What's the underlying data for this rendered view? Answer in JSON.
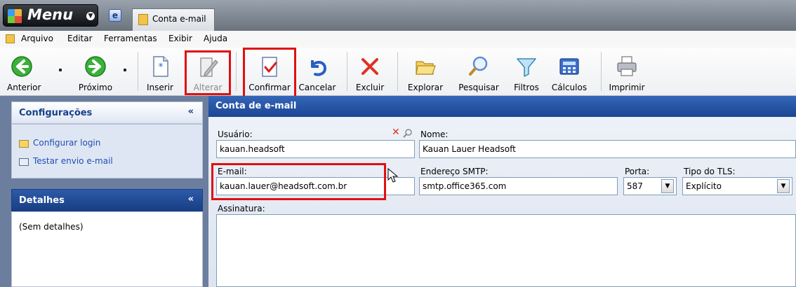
{
  "topbar": {
    "menu_label": "Menu",
    "doc_tab_label": "Conta e-mail"
  },
  "menubar": {
    "items": [
      "Arquivo",
      "Editar",
      "Ferramentas",
      "Exibir",
      "Ajuda"
    ]
  },
  "toolbar": {
    "buttons": [
      {
        "label": "Anterior",
        "icon": "arrow-left-icon"
      },
      {
        "label": "Próximo",
        "icon": "arrow-right-icon"
      },
      {
        "label": "Inserir",
        "icon": "new-document-icon"
      },
      {
        "label": "Alterar",
        "icon": "pencil-edit-icon",
        "disabled": true
      },
      {
        "label": "Confirmar",
        "icon": "checkmark-icon"
      },
      {
        "label": "Cancelar",
        "icon": "undo-icon"
      },
      {
        "label": "Excluir",
        "icon": "delete-x-icon"
      },
      {
        "label": "Explorar",
        "icon": "folder-open-icon"
      },
      {
        "label": "Pesquisar",
        "icon": "magnifier-icon"
      },
      {
        "label": "Filtros",
        "icon": "funnel-icon"
      },
      {
        "label": "Cálculos",
        "icon": "calculator-icon"
      },
      {
        "label": "Imprimir",
        "icon": "printer-icon"
      }
    ],
    "highlight_color": "#e01010"
  },
  "sidebar": {
    "config_title": "Configurações",
    "config_links": [
      "Configurar login",
      "Testar envio e-mail"
    ],
    "details_title": "Detalhes",
    "details_text": "(Sem detalhes)"
  },
  "form": {
    "title": "Conta de e-mail",
    "usuario": {
      "label": "Usuário:",
      "value": "kauan.headsoft"
    },
    "nome": {
      "label": "Nome:",
      "value": "Kauan Lauer Headsoft"
    },
    "email": {
      "label": "E-mail:",
      "value": "kauan.lauer@headsoft.com.br"
    },
    "smtp": {
      "label": "Endereço SMTP:",
      "value": "smtp.office365.com"
    },
    "porta": {
      "label": "Porta:",
      "value": "587"
    },
    "tls": {
      "label": "Tipo do TLS:",
      "value": "Explícito"
    },
    "assinatura": {
      "label": "Assinatura:",
      "value": ""
    }
  },
  "colors": {
    "header_blue": "#1b4594",
    "sidebar_bg": "#6b7e9e",
    "accent_red": "#e01010"
  }
}
